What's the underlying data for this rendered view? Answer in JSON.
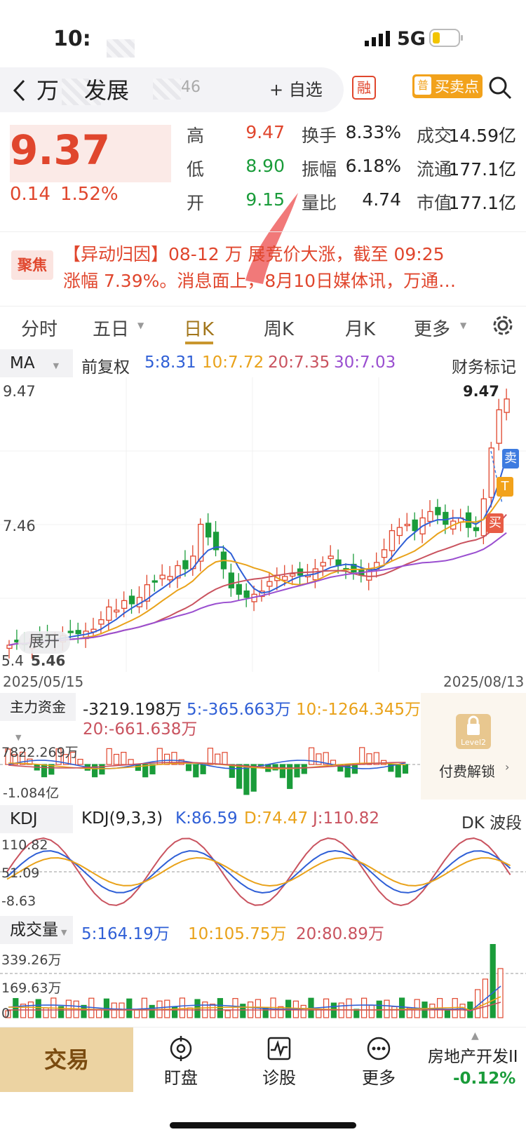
{
  "status": {
    "time": "10:",
    "network": "5G"
  },
  "header": {
    "back_icon": "chevron-left-icon",
    "stock_name_left": "万",
    "stock_name_right": "发展",
    "stock_code_tail": "46",
    "add_watch": "+ 自选",
    "margin_badge": "融",
    "buy_sell_badge_prefix": "普",
    "buy_sell_badge": "买卖点",
    "search_icon": "search-icon"
  },
  "quote": {
    "price": "9.37",
    "change": "0.14",
    "change_pct": "1.52%",
    "rows": [
      [
        {
          "label": "高",
          "value": "9.47",
          "color": "red"
        },
        {
          "label": "换手",
          "value": "8.33%"
        },
        {
          "label": "成交",
          "value": "14.59亿"
        }
      ],
      [
        {
          "label": "低",
          "value": "8.90",
          "color": "green"
        },
        {
          "label": "振幅",
          "value": "6.18%"
        },
        {
          "label": "流通",
          "value": "177.1亿"
        }
      ],
      [
        {
          "label": "开",
          "value": "9.15",
          "color": "green"
        },
        {
          "label": "量比",
          "value": "4.74"
        },
        {
          "label": "市值",
          "value": "177.1亿"
        }
      ]
    ]
  },
  "news": {
    "badge": "聚焦",
    "line1": "【异动归因】08-12 万   展竞价大涨，截至 09:25",
    "line2": "涨幅 7.39%。消息面上，8月10日媒体讯，万通…"
  },
  "tabs": {
    "items": [
      "分时",
      "五日",
      "日K",
      "周K",
      "月K",
      "更多"
    ],
    "active": "日K",
    "settings_icon": "gear-icon"
  },
  "kline": {
    "indicator": "MA",
    "adjust": "前复权",
    "ma5": "5:8.31",
    "ma10": "10:7.72",
    "ma20": "20:7.35",
    "ma30": "30:7.03",
    "finance_mark": "财务标记",
    "axis_top": "9.47",
    "axis_mid": "7.46",
    "axis_low": "5.46",
    "axis_low_cut": "5.4",
    "high_label": "9.47",
    "expand": "展开",
    "date_start": "2025/05/15",
    "date_end": "2025/08/13",
    "sell_tag": "卖",
    "t_tag": "T",
    "buy_tag": "买",
    "colors": {
      "up": "#e0462d",
      "down": "#1a9c3a",
      "ma5": "#2f5fd6",
      "ma10": "#e9a21a",
      "ma20": "#c9535f",
      "ma30": "#9a4fd0"
    }
  },
  "fund": {
    "label": "主力资金",
    "main": "-3219.198万",
    "ma5": "5:-365.663万",
    "ma10": "10:-1264.345万",
    "ma20": "20:-661.638万",
    "axis_top": "7822.269万",
    "axis_bottom": "-1.084亿",
    "lock_sub": "Level2",
    "unlock": "付费解锁"
  },
  "kdj": {
    "label": "KDJ",
    "params": "KDJ(9,3,3)",
    "k": "K:86.59",
    "d": "D:74.47",
    "j": "J:110.82",
    "dk": "DK 波段",
    "axis_top": "110.82",
    "axis_mid": "51.09",
    "axis_bottom": "-8.63"
  },
  "volume": {
    "label": "成交量",
    "ma5": "5:164.19万",
    "ma10": "10:105.75万",
    "ma20": "20:80.89万",
    "axis_top": "339.26万",
    "axis_mid": "169.63万",
    "axis_bottom": "0"
  },
  "bottom": {
    "trade": "交易",
    "items": [
      {
        "label": "盯盘",
        "icon": "target-icon"
      },
      {
        "label": "诊股",
        "icon": "pulse-chart-icon"
      },
      {
        "label": "更多",
        "icon": "more-dots-icon"
      }
    ],
    "sector": "房地产开发II",
    "sector_change": "-0.12%"
  }
}
